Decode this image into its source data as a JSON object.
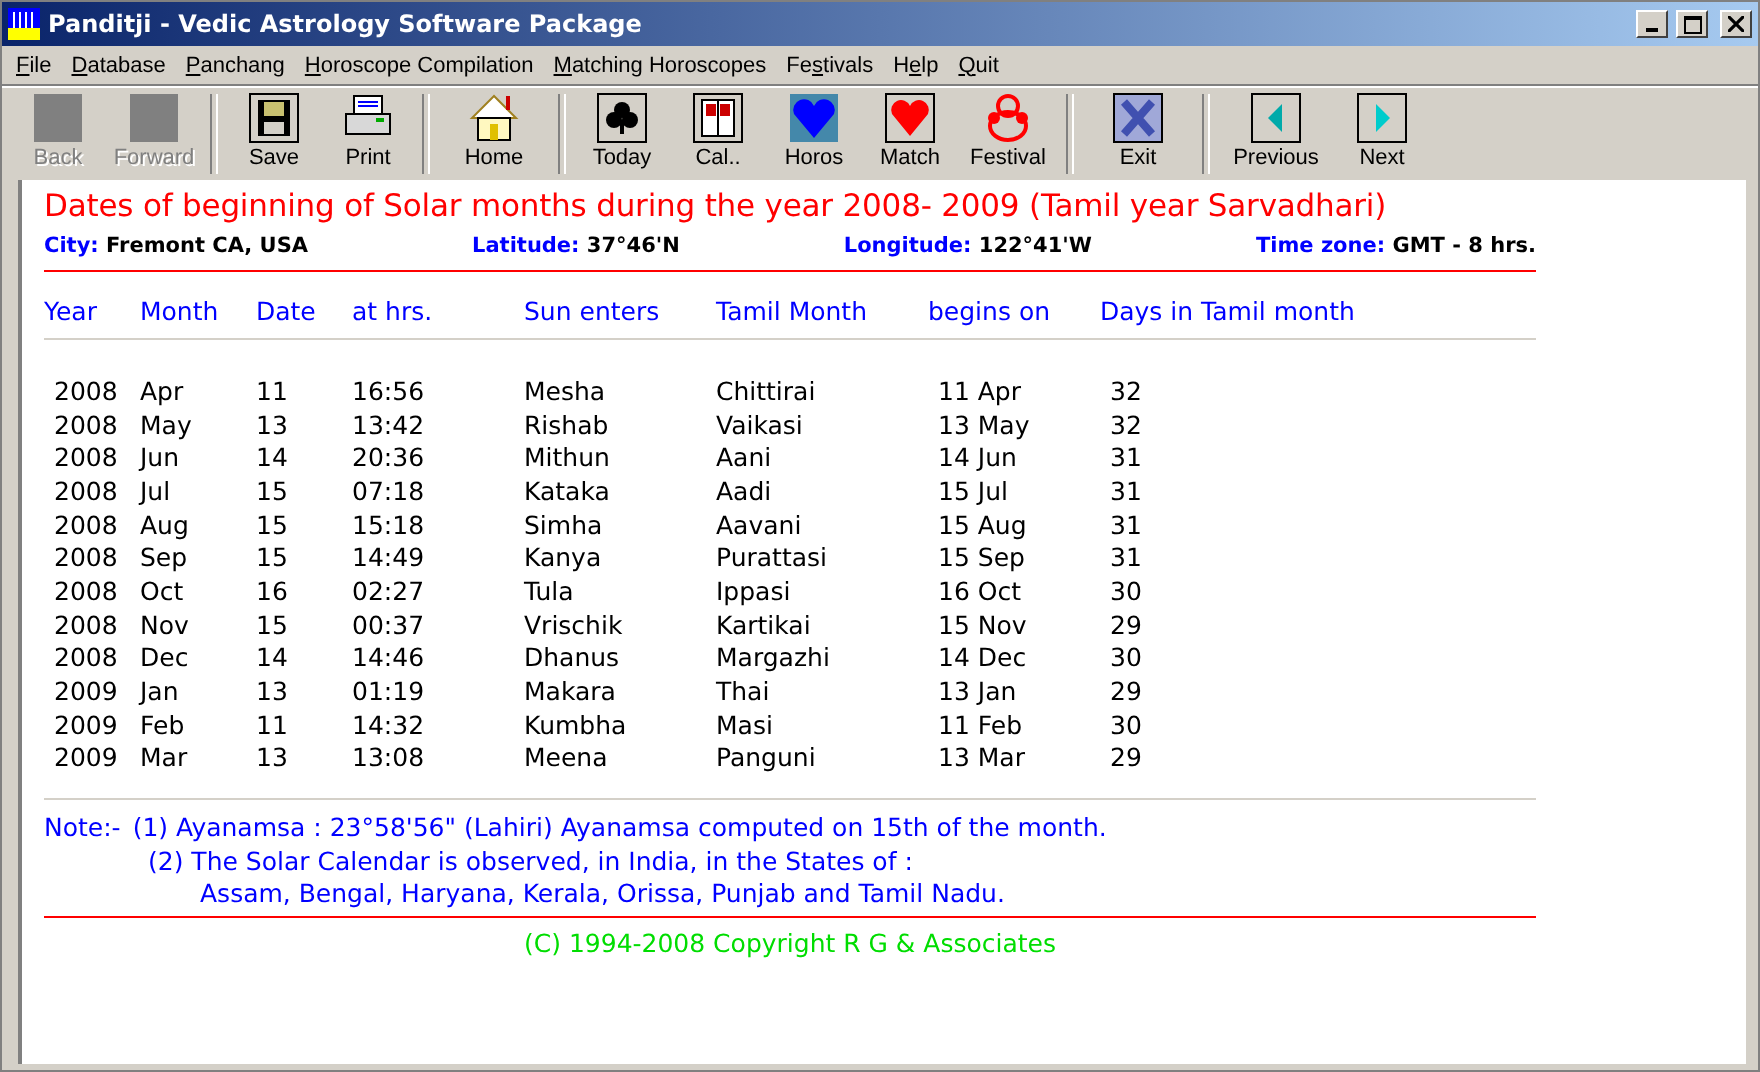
{
  "window": {
    "title": "Panditji - Vedic Astrology Software Package"
  },
  "menu": [
    {
      "label": "File"
    },
    {
      "label": "Database"
    },
    {
      "label": "Panchang"
    },
    {
      "label": "Horoscope Compilation"
    },
    {
      "label": "Matching Horoscopes"
    },
    {
      "label": "Festivals"
    },
    {
      "label": "Help"
    },
    {
      "label": "Quit"
    }
  ],
  "toolbar": [
    [
      {
        "label": "Back",
        "disabled": true
      },
      {
        "label": "Forward",
        "disabled": true
      }
    ],
    [
      {
        "label": "Save",
        "disabled": false
      },
      {
        "label": "Print",
        "disabled": false
      }
    ],
    [
      {
        "label": "Home",
        "disabled": false
      }
    ],
    [
      {
        "label": "Today",
        "disabled": false
      },
      {
        "label": "Cal..",
        "disabled": false
      },
      {
        "label": "Horos",
        "disabled": false
      },
      {
        "label": "Match",
        "disabled": false
      },
      {
        "label": "Festival",
        "disabled": false
      }
    ],
    [
      {
        "label": "Exit",
        "disabled": false
      }
    ],
    [
      {
        "label": "Previous",
        "disabled": false
      },
      {
        "label": "Next",
        "disabled": false
      }
    ]
  ],
  "report": {
    "title": "Dates of beginning of Solar months during the year 2008- 2009 (Tamil year Sarvadhari)",
    "info": [
      {
        "label": "City:",
        "value": "Fremont CA, USA"
      },
      {
        "label": "Latitude:",
        "value": "37°46'N"
      },
      {
        "label": "Longitude:",
        "value": "122°41'W"
      },
      {
        "label": "Time zone:",
        "value": "GMT - 8 hrs."
      }
    ],
    "columns": [
      "Year",
      "Month",
      "Date",
      "at hrs.",
      "Sun enters",
      "Tamil Month",
      "begins on",
      "Days in Tamil month"
    ],
    "rows": [
      [
        "2008",
        "Apr",
        "11",
        "16:56",
        "Mesha",
        "Chittirai",
        "11 Apr",
        "32"
      ],
      [
        "2008",
        "May",
        "13",
        "13:42",
        "Rishab",
        "Vaikasi",
        "13 May",
        "32"
      ],
      [
        "2008",
        "Jun",
        "14",
        "20:36",
        "Mithun",
        "Aani",
        "14 Jun",
        "31"
      ],
      [
        "2008",
        "Jul",
        "15",
        "07:18",
        "Kataka",
        "Aadi",
        "15 Jul",
        "31"
      ],
      [
        "2008",
        "Aug",
        "15",
        "15:18",
        "Simha",
        "Aavani",
        "15 Aug",
        "31"
      ],
      [
        "2008",
        "Sep",
        "15",
        "14:49",
        "Kanya",
        "Purattasi",
        "15 Sep",
        "31"
      ],
      [
        "2008",
        "Oct",
        "16",
        "02:27",
        "Tula",
        "Ippasi",
        "16 Oct",
        "30"
      ],
      [
        "2008",
        "Nov",
        "15",
        "00:37",
        "Vrischik",
        "Kartikai",
        "15 Nov",
        "29"
      ],
      [
        "2008",
        "Dec",
        "14",
        "14:46",
        "Dhanus",
        "Margazhi",
        "14 Dec",
        "30"
      ],
      [
        "2009",
        "Jan",
        "13",
        "01:19",
        "Makara",
        "Thai",
        "13 Jan",
        "29"
      ],
      [
        "2009",
        "Feb",
        "11",
        "14:32",
        "Kumbha",
        "Masi",
        "11 Feb",
        "30"
      ],
      [
        "2009",
        "Mar",
        "13",
        "13:08",
        "Meena",
        "Panguni",
        "13 Mar",
        "29"
      ]
    ],
    "note_label": "Note:-",
    "notes": [
      {
        "text": "(1) Ayanamsa : 23°58'56\"  (Lahiri)  Ayanamsa computed on 15th of the month."
      },
      {
        "text": "(2) The Solar Calendar is observed, in India, in the States of :",
        "continuation": "Assam, Bengal, Haryana, Kerala, Orissa, Punjab and Tamil Nadu."
      }
    ],
    "copyright": "(C) 1994-2008 Copyright R G & Associates"
  }
}
